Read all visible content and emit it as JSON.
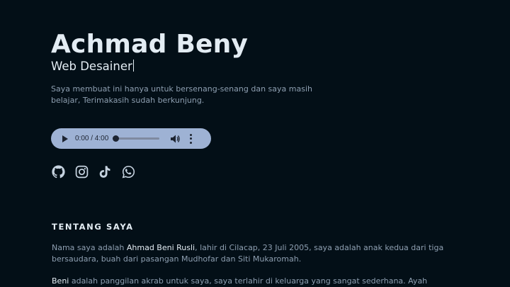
{
  "hero": {
    "name": "Achmad Beny",
    "role": "Web Desainer",
    "description": "Saya membuat ini hanya untuk bersenang-senang dan saya masih belajar, Terimakasih sudah berkunjung."
  },
  "audio": {
    "time": "0:00 / 4:00",
    "progress_fraction": 0,
    "icons": {
      "play": "play-icon",
      "volume": "volume-icon",
      "menu": "more-vertical-icon"
    },
    "colors": {
      "background": "#9eb2d4",
      "foreground": "#1d2431"
    }
  },
  "socials": [
    {
      "icon": "github-icon"
    },
    {
      "icon": "instagram-icon"
    },
    {
      "icon": "tiktok-icon"
    },
    {
      "icon": "whatsapp-icon"
    }
  ],
  "about": {
    "title": "TENTANG SAYA",
    "p1_before": "Nama saya adalah ",
    "p1_name": "Ahmad Beni Rusli",
    "p1_after": ", lahir di Cilacap, 23 Juli 2005, saya adalah anak kedua dari tiga bersaudara, buah dari pasangan Mudhofar dan Siti Mukaromah.",
    "p2_name": "Beni",
    "p2_after": " adalah panggilan akrab untuk saya, saya terlahir di keluarga yang sangat sederhana. Ayah"
  },
  "colors": {
    "background": "#030f17",
    "heading": "#e3ecf3",
    "body_text": "#8e9fb1",
    "icon": "#c6d3e0"
  }
}
